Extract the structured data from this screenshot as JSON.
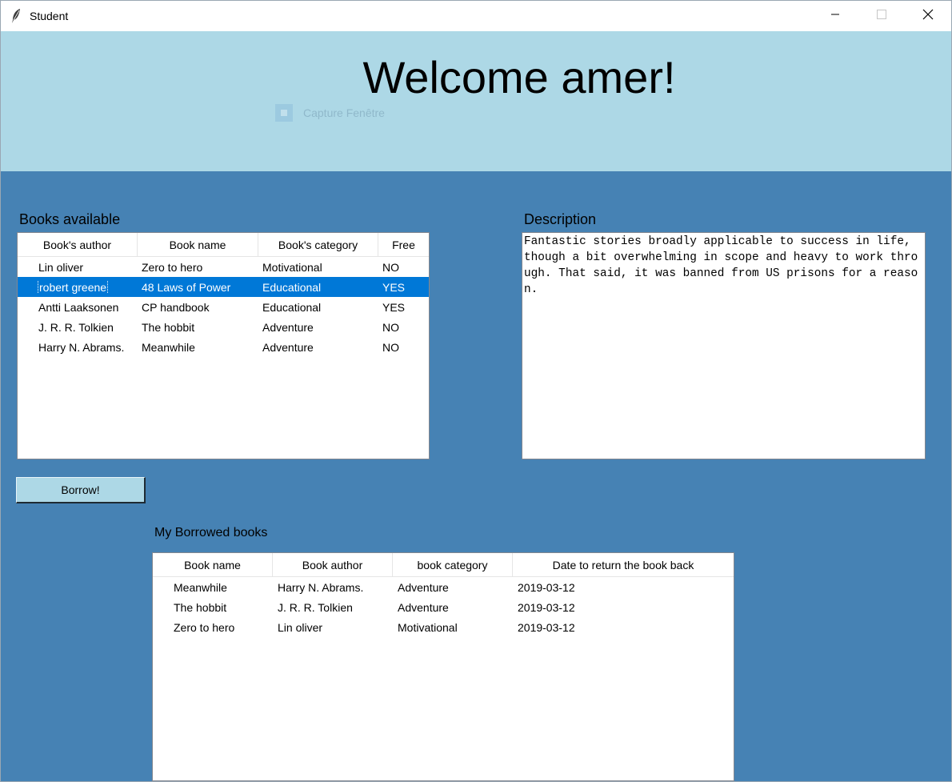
{
  "window": {
    "title": "Student",
    "icon": "feather-icon"
  },
  "header": {
    "welcome": "Welcome amer!",
    "capture_label": "Capture Fenêtre"
  },
  "books_available": {
    "label": "Books available",
    "columns": [
      "Book's author",
      "Book name",
      "Book's category",
      "Free"
    ],
    "selected_index": 1,
    "rows": [
      [
        "Lin oliver",
        "Zero to hero",
        "Motivational",
        "NO"
      ],
      [
        "robert greene",
        "48 Laws of Power",
        "Educational",
        "YES"
      ],
      [
        "Antti Laaksonen",
        "CP handbook",
        "Educational",
        "YES"
      ],
      [
        "J. R. R. Tolkien",
        "The hobbit",
        "Adventure",
        "NO"
      ],
      [
        "Harry N. Abrams.",
        "Meanwhile",
        "Adventure",
        "NO"
      ]
    ]
  },
  "description": {
    "label": "Description",
    "text": "Fantastic stories broadly applicable to success in life, though a bit overwhelming in scope and heavy to work through. That said, it was banned from US prisons for a reason."
  },
  "borrow_button": {
    "label": "Borrow!"
  },
  "borrowed": {
    "label": "My Borrowed books",
    "columns": [
      "Book name",
      "Book author",
      "book category",
      "Date to return the book back"
    ],
    "rows": [
      [
        "Meanwhile",
        "Harry N. Abrams.",
        "Adventure",
        "2019-03-12"
      ],
      [
        "The hobbit",
        "J. R. R. Tolkien",
        "Adventure",
        "2019-03-12"
      ],
      [
        "Zero to hero",
        "Lin oliver",
        "Motivational",
        "2019-03-12"
      ]
    ]
  },
  "colors": {
    "background": "#4682b4",
    "header": "#add8e6",
    "selection": "#0078d7",
    "button": "#add8e6"
  }
}
